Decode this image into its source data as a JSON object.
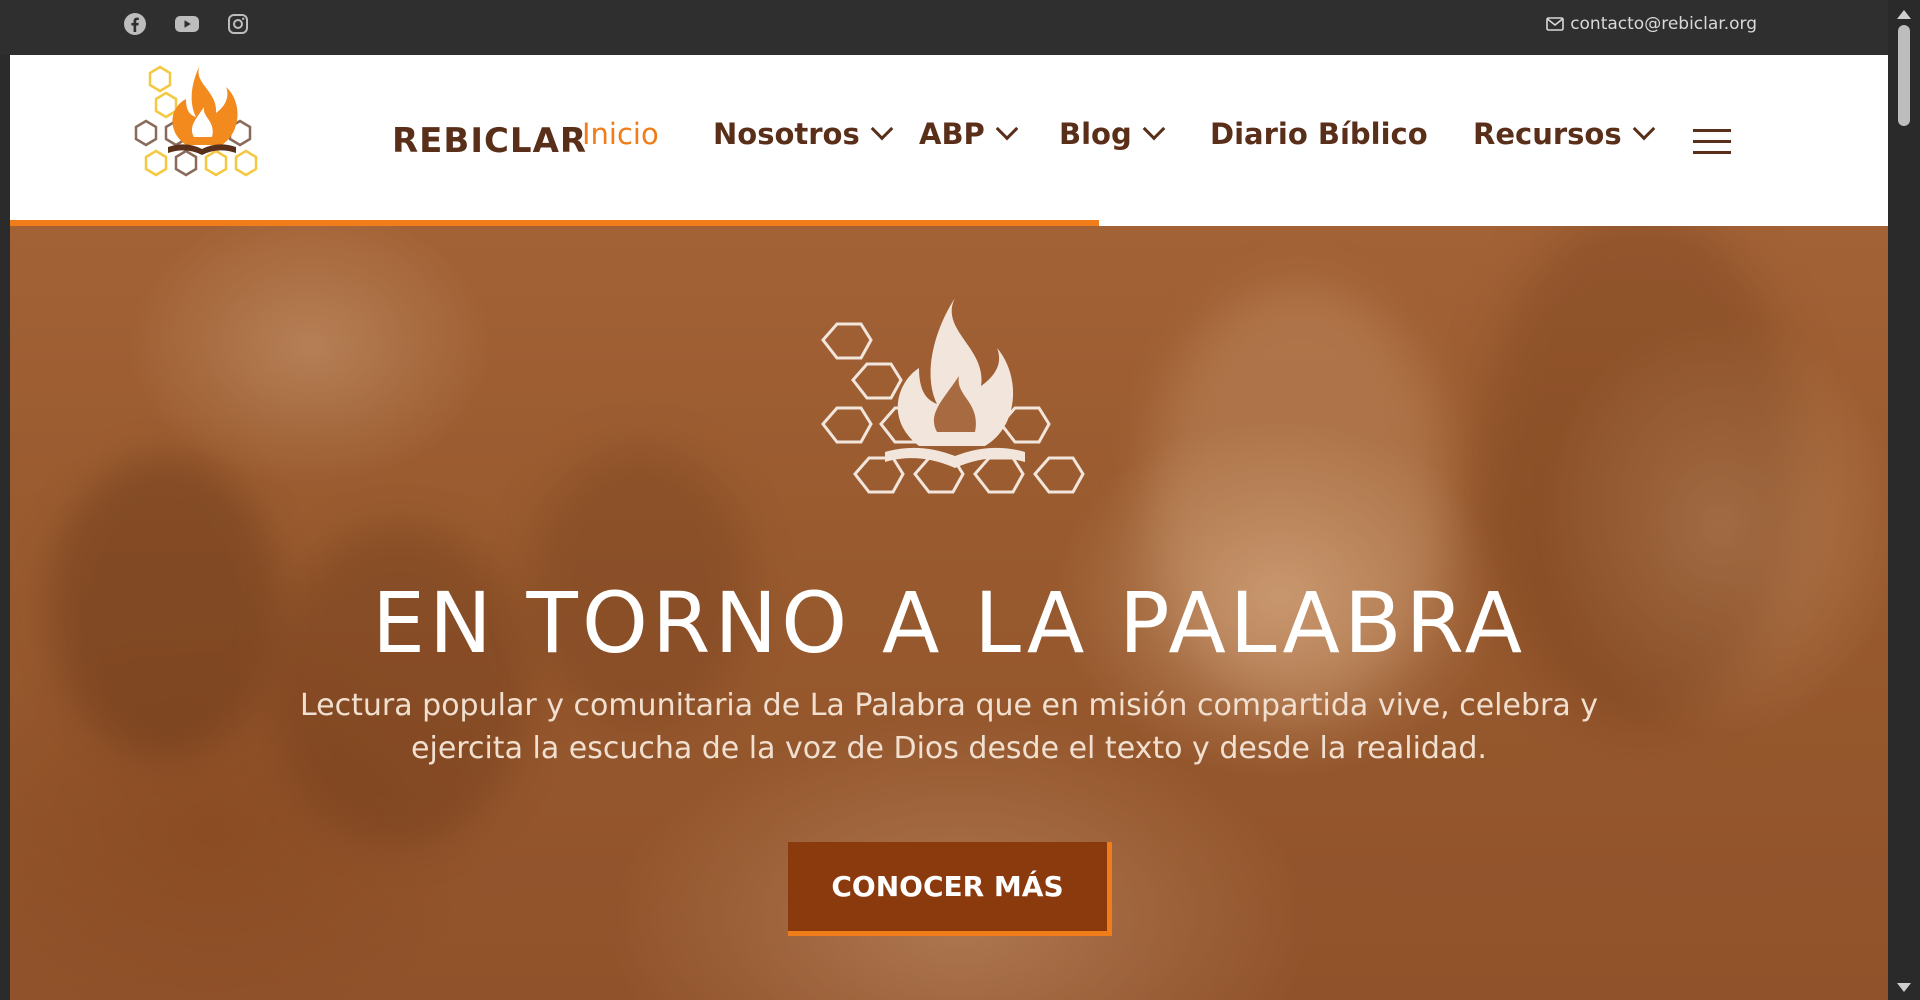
{
  "topbar": {
    "social_icons": [
      "facebook-icon",
      "youtube-icon",
      "instagram-icon"
    ],
    "contact_icon": "envelope-icon",
    "contact_email": "contacto@rebiclar.org"
  },
  "header": {
    "logo_text": "REBICLAR",
    "nav": [
      {
        "label": "Inicio",
        "active": true,
        "dropdown": false
      },
      {
        "label": "Nosotros",
        "active": false,
        "dropdown": true
      },
      {
        "label": "ABP",
        "active": false,
        "dropdown": true
      },
      {
        "label": "Blog",
        "active": false,
        "dropdown": true
      },
      {
        "label": "Diario Bíblico",
        "active": false,
        "dropdown": false
      },
      {
        "label": "Recursos",
        "active": false,
        "dropdown": true
      }
    ],
    "menu_icon": "hamburger-menu-icon",
    "scroll_progress": 0.58
  },
  "hero": {
    "title": "EN TORNO A LA PALABRA",
    "subtitle_line1": "Lectura popular y comunitaria de La Palabra que en misión compartida vive, celebra y",
    "subtitle_line2": "ejercita la escucha de la voz de Dios desde el texto y desde la realidad.",
    "cta_label": "CONOCER MÁS"
  },
  "colors": {
    "accent": "#f07d1a",
    "brand_brown": "#5a2f1a",
    "cta_bg": "#8a3a0c",
    "topbar_bg": "#2f2f2f"
  }
}
